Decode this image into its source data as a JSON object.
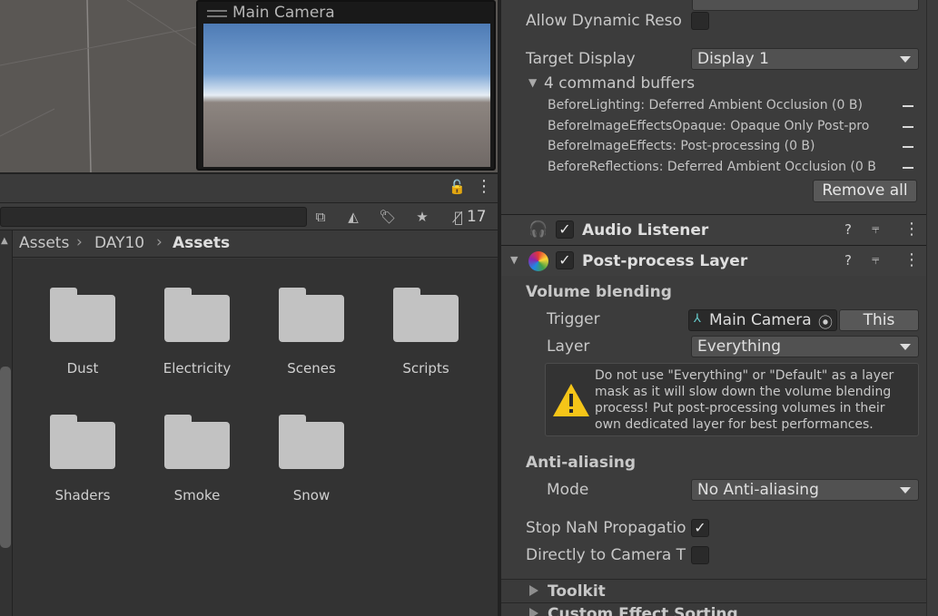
{
  "scene": {
    "camera_preview_title": "Main Camera"
  },
  "project": {
    "hidden_count": "17",
    "breadcrumb": [
      "Assets",
      "DAY10",
      "Assets"
    ],
    "folders": [
      "Dust",
      "Electricity",
      "Scenes",
      "Scripts",
      "Shaders",
      "Smoke",
      "Snow"
    ]
  },
  "inspector": {
    "allow_dynamic_label": "Allow Dynamic Reso",
    "target_display_label": "Target Display",
    "target_display_value": "Display 1",
    "command_buffers_label": "4 command buffers",
    "command_buffers": [
      "BeforeLighting: Deferred Ambient Occlusion (0 B)",
      "BeforeImageEffectsOpaque: Opaque Only Post-pro",
      "BeforeImageEffects: Post-processing (0 B)",
      "BeforeReflections: Deferred Ambient Occlusion (0 B"
    ],
    "remove_all_label": "Remove all",
    "audio_listener_title": "Audio Listener",
    "post_process_title": "Post-process Layer",
    "volume_blending_label": "Volume blending",
    "trigger_label": "Trigger",
    "trigger_value": "Main Camera",
    "this_button": "This",
    "layer_label": "Layer",
    "layer_value": "Everything",
    "warning_text": "Do not use \"Everything\" or \"Default\" as a layer mask as it will slow down the volume blending process! Put post-processing volumes in their own dedicated layer for best performances.",
    "anti_aliasing_label": "Anti-aliasing",
    "mode_label": "Mode",
    "mode_value": "No Anti-aliasing",
    "stop_nan_label": "Stop NaN Propagatio",
    "directly_camera_label": "Directly to Camera T",
    "toolkit_label": "Toolkit",
    "custom_sorting_label": "Custom Effect Sorting"
  },
  "colors": {
    "warning": "#f5c518",
    "panel": "#3c3c3c",
    "scene": "#5a5754"
  }
}
